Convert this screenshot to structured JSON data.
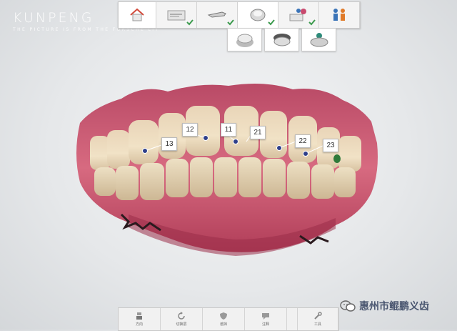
{
  "brand": {
    "name": "KUNPENG",
    "subtitle": "THE PICTURE IS FROM THE FORSCHE LIT"
  },
  "workflow_steps": [
    {
      "icon": "home-icon",
      "completed": false
    },
    {
      "icon": "patient-form-icon",
      "completed": true
    },
    {
      "icon": "scanner-icon",
      "completed": true
    },
    {
      "icon": "jaw-scan-icon",
      "completed": true,
      "active": true
    },
    {
      "icon": "design-icon",
      "completed": true
    },
    {
      "icon": "patient-icon",
      "completed": false
    }
  ],
  "sub_steps": [
    {
      "icon": "upper-jaw-icon"
    },
    {
      "icon": "lower-jaw-icon"
    },
    {
      "icon": "bite-icon"
    }
  ],
  "tooth_labels": [
    "13",
    "12",
    "11",
    "21",
    "22",
    "23"
  ],
  "toolbar": {
    "items": [
      {
        "icon": "direction-icon",
        "label": "方向"
      },
      {
        "icon": "rotate-icon",
        "label": "切换层"
      },
      {
        "icon": "shield-icon",
        "label": "遮挡"
      },
      {
        "icon": "comment-icon",
        "label": "注释"
      },
      {
        "icon": "wrench-icon",
        "label": "工具"
      }
    ]
  },
  "watermark": {
    "text": "惠州市鲲鹏义齿"
  },
  "colors": {
    "accent_check": "#3c9b4e",
    "gum": "#c8506a",
    "marker": "#2f3f8a"
  }
}
